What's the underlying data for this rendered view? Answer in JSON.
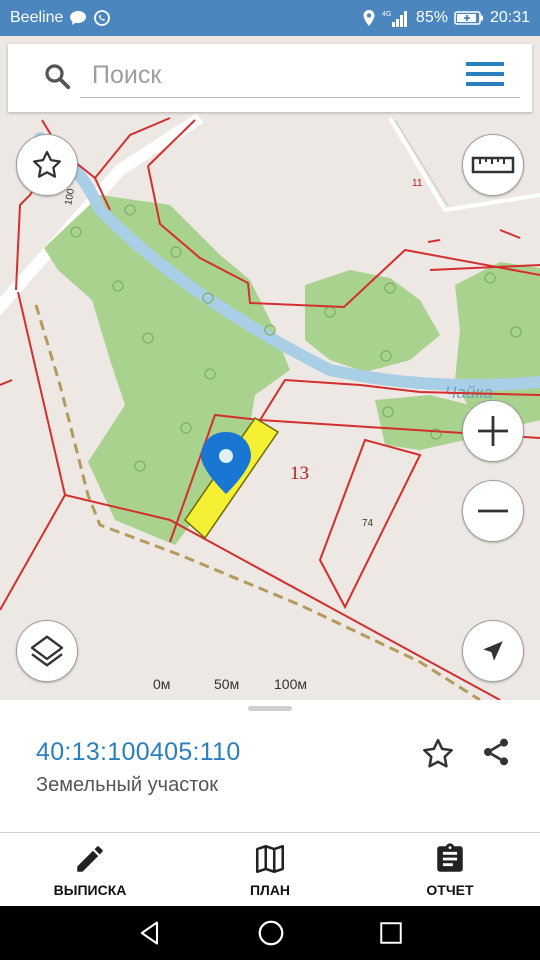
{
  "status_bar": {
    "carrier": "Beeline",
    "network": "4G",
    "battery": "85%",
    "time": "20:31",
    "icons": [
      "chat-icon",
      "whatsapp-icon",
      "location-icon",
      "signal-icon",
      "battery-icon"
    ]
  },
  "search": {
    "placeholder": "Поиск",
    "icons": [
      "search-icon",
      "menu-icon"
    ]
  },
  "map": {
    "parcel_number": "13",
    "label_74": "74",
    "label_11": "11",
    "label_100": "100",
    "river_label": "Чайка",
    "scale": {
      "labels": [
        "0м",
        "50м",
        "100м"
      ]
    },
    "buttons": [
      "favorite-star-icon",
      "ruler-icon",
      "zoom-in-icon",
      "zoom-out-icon",
      "layers-icon",
      "my-location-icon"
    ],
    "colors": {
      "boundary": "#d32f2f",
      "selected": "#f5f033",
      "forest": "#a8d28e",
      "water": "#a9cfe6",
      "pin": "#1976d2"
    }
  },
  "info": {
    "cadastral_number": "40:13:100405:110",
    "object_type": "Земельный участок"
  },
  "bottom_nav": {
    "items": [
      {
        "label": "ВЫПИСКА",
        "icon": "pencil-icon"
      },
      {
        "label": "ПЛАН",
        "icon": "map-icon"
      },
      {
        "label": "ОТЧЕТ",
        "icon": "clipboard-icon"
      }
    ]
  }
}
